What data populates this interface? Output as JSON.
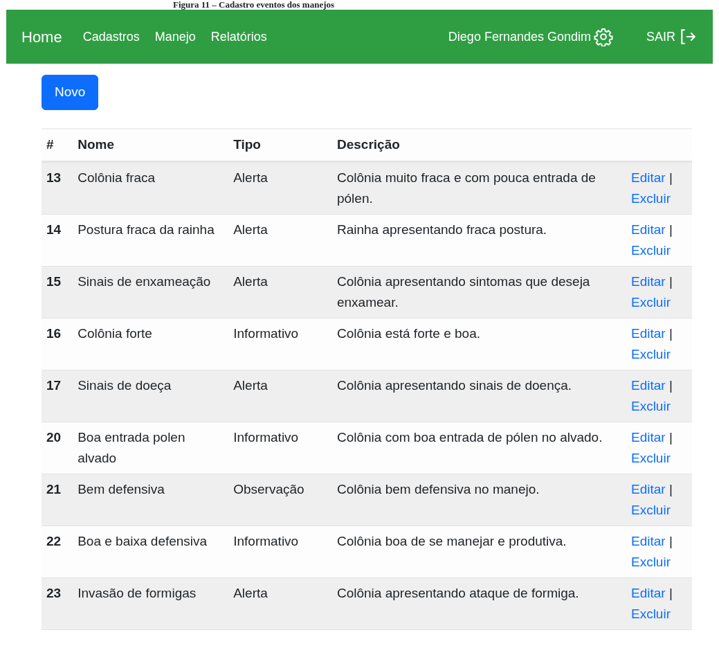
{
  "caption": "Figura 11 – Cadastro eventos dos manejos",
  "navbar": {
    "brand": "Home",
    "links": [
      "Cadastros",
      "Manejo",
      "Relatórios"
    ],
    "user": "Diego Fernandes Gondim",
    "logout": "SAIR"
  },
  "new_button": "Novo",
  "table": {
    "columns": [
      "#",
      "Nome",
      "Tipo",
      "Descrição"
    ],
    "rows": [
      {
        "id": "13",
        "nome": "Colônia fraca",
        "tipo": "Alerta",
        "descricao": "Colônia muito fraca e com pouca entrada de pólen.",
        "edit": "Editar",
        "sep": "|",
        "delete": "Excluir"
      },
      {
        "id": "14",
        "nome": "Postura fraca da rainha",
        "tipo": "Alerta",
        "descricao": "Rainha apresentando fraca postura.",
        "edit": "Editar",
        "sep": "|",
        "delete": "Excluir"
      },
      {
        "id": "15",
        "nome": "Sinais de enxameação",
        "tipo": "Alerta",
        "descricao": "Colônia apresentando sintomas que deseja enxamear.",
        "edit": "Editar",
        "sep": "|",
        "delete": "Excluir"
      },
      {
        "id": "16",
        "nome": "Colônia forte",
        "tipo": "Informativo",
        "descricao": "Colônia está forte e boa.",
        "edit": "Editar",
        "sep": "|",
        "delete": "Excluir"
      },
      {
        "id": "17",
        "nome": "Sinais de doeça",
        "tipo": "Alerta",
        "descricao": "Colônia apresentando sinais de doença.",
        "edit": "Editar",
        "sep": "|",
        "delete": "Excluir"
      },
      {
        "id": "20",
        "nome": "Boa entrada polen alvado",
        "tipo": "Informativo",
        "descricao": "Colônia com boa entrada de pólen no alvado.",
        "edit": "Editar",
        "sep": "|",
        "delete": "Excluir"
      },
      {
        "id": "21",
        "nome": "Bem defensiva",
        "tipo": "Observação",
        "descricao": "Colônia bem defensiva no manejo.",
        "edit": "Editar",
        "sep": "|",
        "delete": "Excluir"
      },
      {
        "id": "22",
        "nome": "Boa e baixa defensiva",
        "tipo": "Informativo",
        "descricao": "Colônia boa de se manejar e produtiva.",
        "edit": "Editar",
        "sep": "|",
        "delete": "Excluir"
      },
      {
        "id": "23",
        "nome": "Invasão de formigas",
        "tipo": "Alerta",
        "descricao": "Colônia apresentando ataque de formiga.",
        "edit": "Editar",
        "sep": "|",
        "delete": "Excluir"
      }
    ]
  }
}
